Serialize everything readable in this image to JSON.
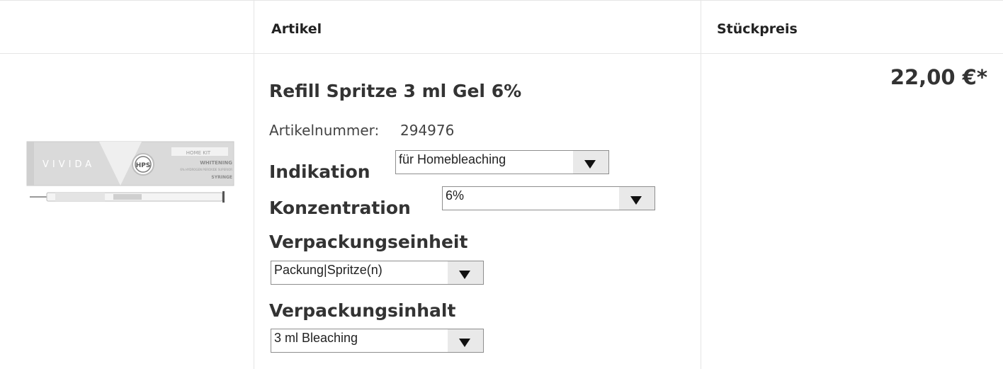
{
  "table": {
    "headers": {
      "image": "",
      "article": "Artikel",
      "unit_price": "Stückpreis"
    }
  },
  "product": {
    "name": "Refill Spritze 3 ml Gel 6%",
    "article_number_label": "Artikelnummer:",
    "article_number": "294976",
    "price": "22,00 €*",
    "image": {
      "box_brand": "VIVIDA",
      "box_badge": "HPS",
      "box_tag": "HOME KIT",
      "box_line1": "WHITENING",
      "box_line2": "6% HYDROGEN PEROXIDE SUPERIOR",
      "box_line3": "SYRINGE"
    },
    "options": {
      "indikation": {
        "label": "Indikation",
        "value": "für Homebleaching"
      },
      "konzentration": {
        "label": "Konzentration",
        "value": "6%"
      },
      "verpackungseinheit": {
        "label": "Verpackungseinheit",
        "value": "Packung|Spritze(n)"
      },
      "verpackungsinhalt": {
        "label": "Verpackungsinhalt",
        "value": "3 ml Bleaching"
      }
    }
  }
}
